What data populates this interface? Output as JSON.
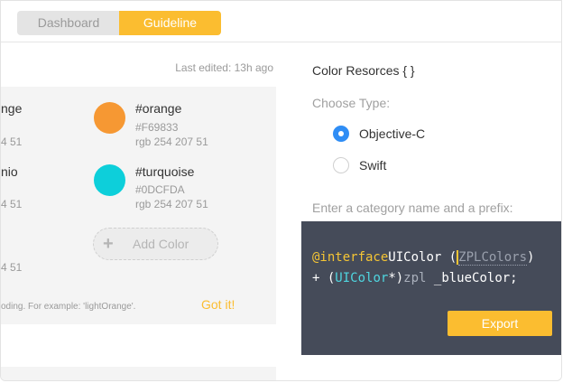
{
  "tabs": {
    "dashboard": "Dashboard",
    "guideline": "Guideline"
  },
  "last_edited": "Last edited: 13h ago",
  "left_cut": {
    "row1_name": "nge",
    "row1_sub": "4 51",
    "row2_name": "nio",
    "row2_sub": "4 51",
    "row3_sub": "4 51"
  },
  "colors": [
    {
      "name": "#orange",
      "hex": "#F69833",
      "rgb": "rgb 254 207 51",
      "swatch": "#F69833"
    },
    {
      "name": "#turquoise",
      "hex": "#0DCFDA",
      "rgb": "rgb 254 207 51",
      "swatch": "#0DCFDA"
    }
  ],
  "add_color": "Add Color",
  "hint": "oding. For example: 'lightOrange'.",
  "got_it": "Got it!",
  "right": {
    "title": "Color Resorces { }",
    "choose_type": "Choose Type:",
    "options": [
      "Objective-C",
      "Swift"
    ],
    "selected": "Objective-C",
    "enter_label": "Enter a category name and a prefix:"
  },
  "code": {
    "line1_kw": "@interface",
    "line1_type": "UIColor (",
    "line1_placeholder": "ZPLColors",
    "line1_end": ")",
    "line2_plus": "+ (",
    "line2_type": "UIColor",
    "line2_star": "*)",
    "line2_prefix": "zpl",
    "line2_name": " _blueColor;"
  },
  "export_label": "Export",
  "accent_color": "#FBBD30"
}
